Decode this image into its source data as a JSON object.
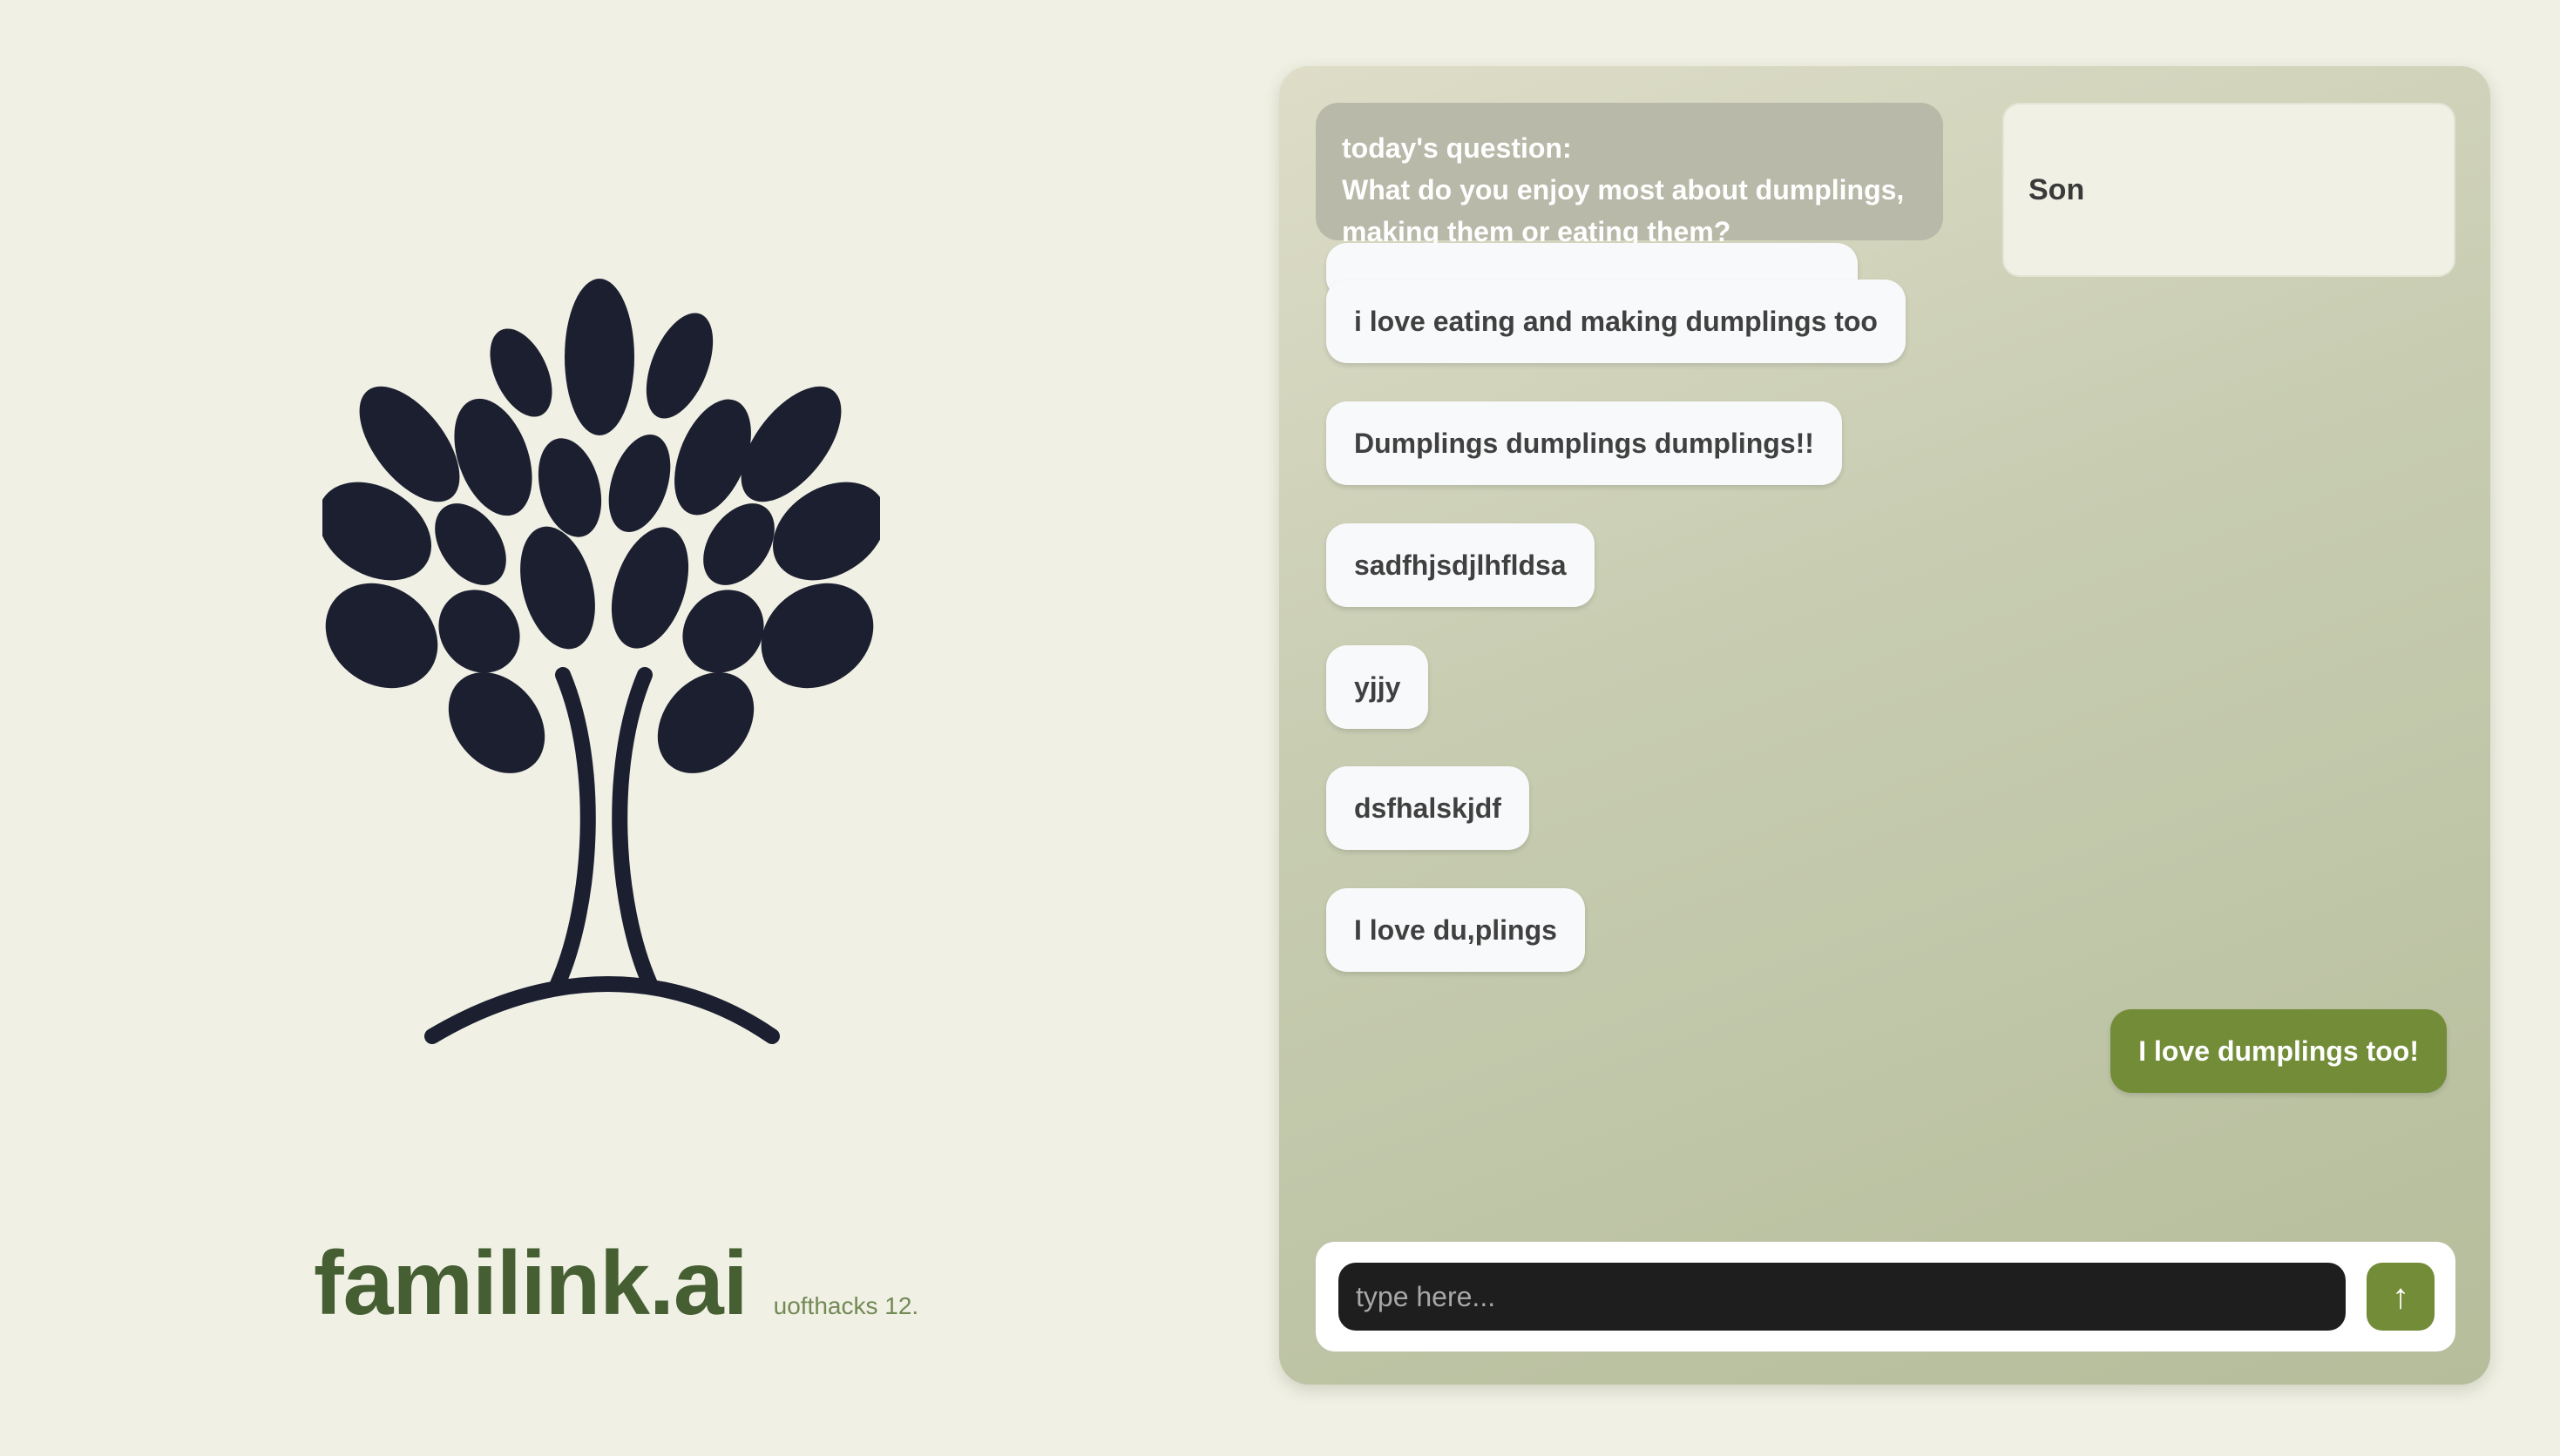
{
  "brand": {
    "name": "familink.ai",
    "tagline": "uofthacks 12."
  },
  "logo": {
    "icon": "tree-icon",
    "color": "#1b1f30"
  },
  "chat": {
    "question_label": "today's question:",
    "question_text": "What do you enjoy most about dumplings, making them or eating them?",
    "user_name": "Son",
    "messages": [
      {
        "text": "i love eating and making dumplings too",
        "mine": false
      },
      {
        "text": "Dumplings dumplings dumplings!!",
        "mine": false
      },
      {
        "text": "sadfhjsdjlhfldsa",
        "mine": false
      },
      {
        "text": "yjjy",
        "mine": false
      },
      {
        "text": "dsfhalskjdf",
        "mine": false
      },
      {
        "text": "I love du,plings",
        "mine": false
      },
      {
        "text": "I love dumplings too!",
        "mine": true
      }
    ],
    "input_placeholder": "type here...",
    "send_icon": "↑"
  },
  "colors": {
    "background": "#f0f0e4",
    "brand_green": "#455f33",
    "accent_green": "#728c38",
    "bubble": "#f8f9fa"
  }
}
